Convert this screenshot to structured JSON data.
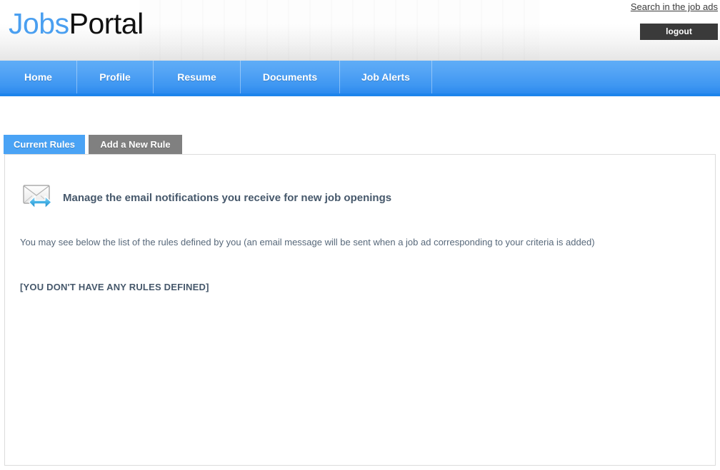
{
  "header": {
    "logo_primary": "Jobs",
    "logo_secondary": "Portal",
    "search_link": "Search in the job ads",
    "logout_label": "logout"
  },
  "nav": {
    "items": [
      {
        "label": "Home"
      },
      {
        "label": "Profile"
      },
      {
        "label": "Resume"
      },
      {
        "label": "Documents"
      },
      {
        "label": "Job Alerts"
      }
    ]
  },
  "tabs": [
    {
      "label": "Current Rules",
      "active": true
    },
    {
      "label": "Add a New Rule",
      "active": false
    }
  ],
  "main": {
    "icon": "email-forward-icon",
    "heading": "Manage the email notifications you receive for new job openings",
    "intro": "You may see below the list of the rules defined by you (an email message will be sent when a job ad corresponding to your criteria is added)",
    "empty_state": "[YOU DON'T HAVE ANY RULES DEFINED]"
  },
  "colors": {
    "accent_blue": "#4a9ff0",
    "nav_blue": "#3f97f2",
    "nav_border": "#1d84ec",
    "tab_active": "#4aa3f5",
    "tab_inactive": "#808080",
    "logout_bg": "#3a3a3a",
    "heading_text": "#46586b",
    "body_text": "#57687a"
  }
}
